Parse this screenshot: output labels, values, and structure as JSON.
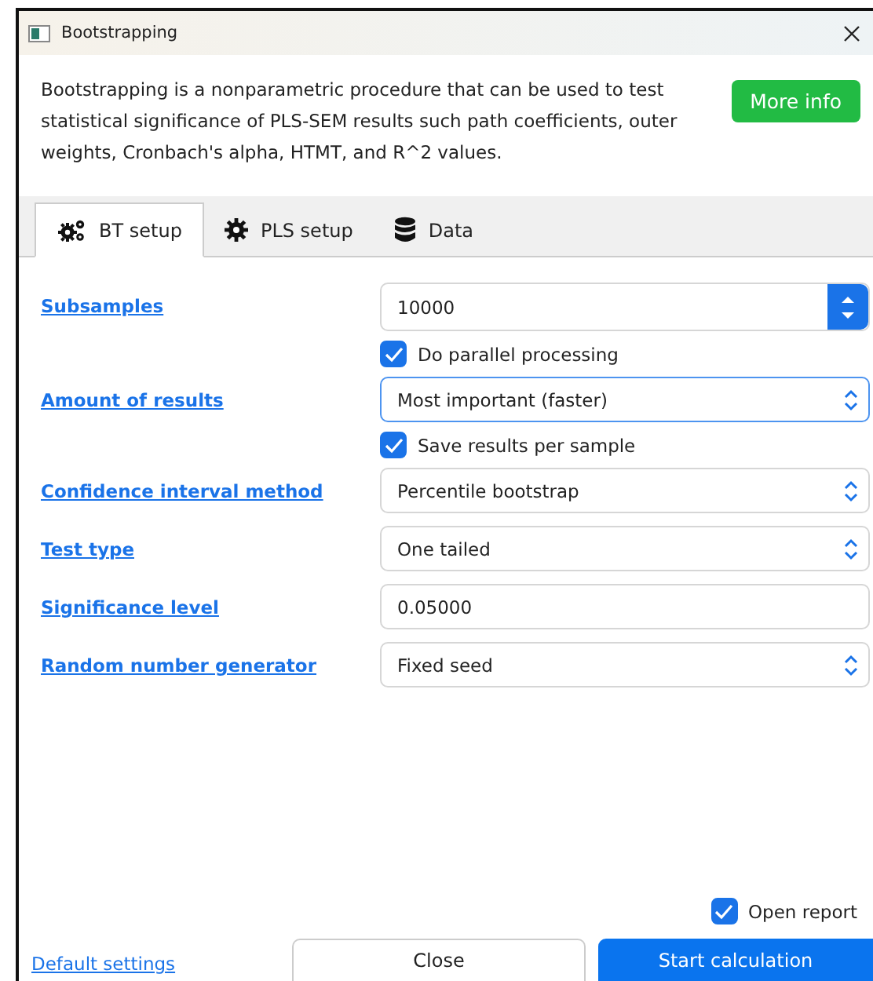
{
  "window": {
    "title": "Bootstrapping"
  },
  "description": "Bootstrapping is a nonparametric procedure that can be used to test statistical significance of PLS-SEM results such path coefficients, outer weights, Cronbach's alpha, HTMT, and R^2 values.",
  "more_info_button": "More info",
  "tabs": [
    {
      "label": "BT setup",
      "selected": true
    },
    {
      "label": "PLS setup",
      "selected": false
    },
    {
      "label": "Data",
      "selected": false
    }
  ],
  "settings": [
    {
      "kind": "spin",
      "label": "Subsamples",
      "value": "10000"
    },
    {
      "kind": "checkbox",
      "label": "Do parallel processing",
      "checked": true
    },
    {
      "kind": "select",
      "label": "Amount of results",
      "value": "Most important (faster)",
      "focused": true
    },
    {
      "kind": "checkbox",
      "label": "Save results per sample",
      "checked": true
    },
    {
      "kind": "select",
      "label": "Confidence interval method",
      "value": "Percentile bootstrap",
      "focused": false
    },
    {
      "kind": "select",
      "label": "Test type",
      "value": "One tailed",
      "focused": false
    },
    {
      "kind": "text",
      "label": "Significance level",
      "value": "0.05000"
    },
    {
      "kind": "select",
      "label": "Random number generator",
      "value": "Fixed seed",
      "focused": false
    }
  ],
  "open_report": {
    "label": "Open report",
    "checked": true
  },
  "footer": {
    "default_link": "Default settings",
    "close_button": "Close",
    "start_button": "Start calculation"
  }
}
